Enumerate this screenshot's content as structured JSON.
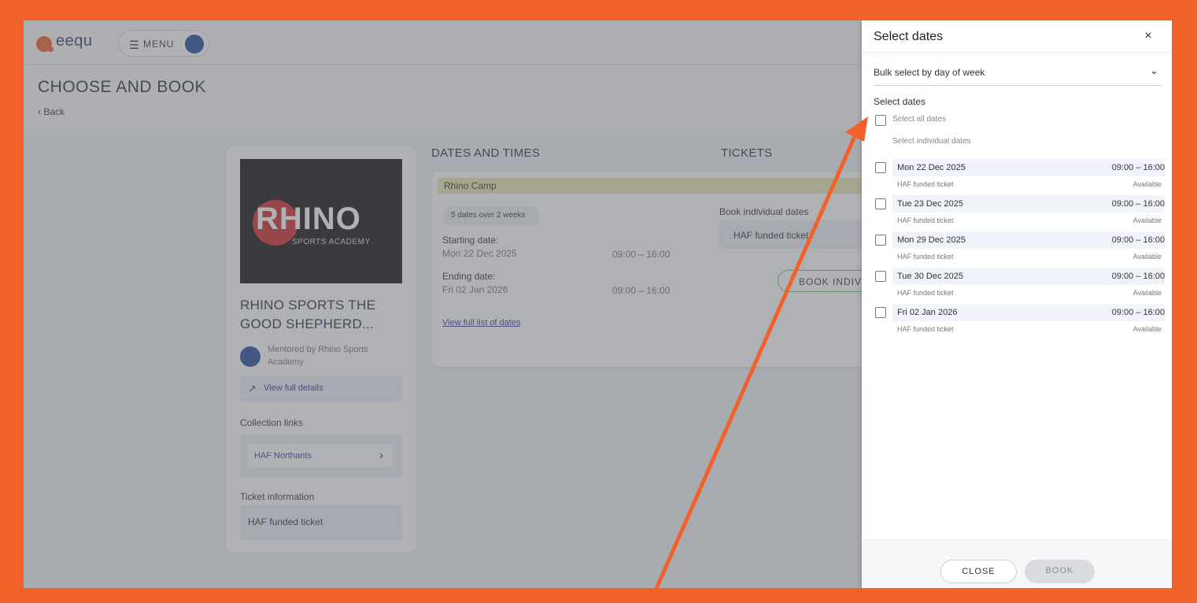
{
  "app": {
    "logo_text": "eequ",
    "menu_label": "MENU"
  },
  "page": {
    "title": "CHOOSE AND BOOK",
    "back_label": "Back"
  },
  "event": {
    "logo_word": "RHINO",
    "logo_sub": "SPORTS ACADEMY",
    "title_line1": "RHINO SPORTS THE",
    "title_line2": "GOOD SHEPHERD...",
    "mentor": "Mentored by Rhino Sports Academy",
    "view_details": "View full details",
    "collection_label": "Collection links",
    "collection_link": "HAF Northants",
    "ticket_info_label": "Ticket information",
    "ticket_info": "HAF funded ticket"
  },
  "dates_section": {
    "heading": "DATES AND TIMES",
    "camp_name": "Rhino Camp",
    "summary": "5 dates over 2 weeks",
    "start_label": "Starting date:",
    "start_value": "Mon 22 Dec 2025",
    "start_time": "09:00 – 16:00",
    "end_label": "Ending date:",
    "end_value": "Fri 02 Jan 2026",
    "end_time": "09:00 – 16:00",
    "full_list": "View full list of dates"
  },
  "tickets_section": {
    "heading": "TICKETS",
    "book_individual_label": "Book individual dates",
    "ticket_option": "HAF funded ticket",
    "book_button": "BOOK INDIV"
  },
  "drawer": {
    "title": "Select dates",
    "close_icon": "×",
    "bulk_select": "Bulk select by day of week",
    "select_dates_label": "Select dates",
    "select_all": "Select all dates",
    "select_individual": "Select individual dates",
    "dates": [
      {
        "date": "Mon 22 Dec 2025",
        "time": "09:00 – 16:00",
        "ticket": "HAF funded ticket",
        "status": "Available"
      },
      {
        "date": "Tue 23 Dec 2025",
        "time": "09:00 – 16:00",
        "ticket": "HAF funded ticket",
        "status": "Available"
      },
      {
        "date": "Mon 29 Dec 2025",
        "time": "09:00 – 16:00",
        "ticket": "HAF funded ticket",
        "status": "Available"
      },
      {
        "date": "Tue 30 Dec 2025",
        "time": "09:00 – 16:00",
        "ticket": "HAF funded ticket",
        "status": "Available"
      },
      {
        "date": "Fri 02 Jan 2026",
        "time": "09:00 – 16:00",
        "ticket": "HAF funded ticket",
        "status": "Available"
      }
    ],
    "close_button": "CLOSE",
    "book_button": "BOOK"
  },
  "colors": {
    "frame": "#f2612a",
    "accent": "#3b3b9b",
    "camp_bar": "#f0e6b4",
    "book_outline": "#6cc26c"
  }
}
